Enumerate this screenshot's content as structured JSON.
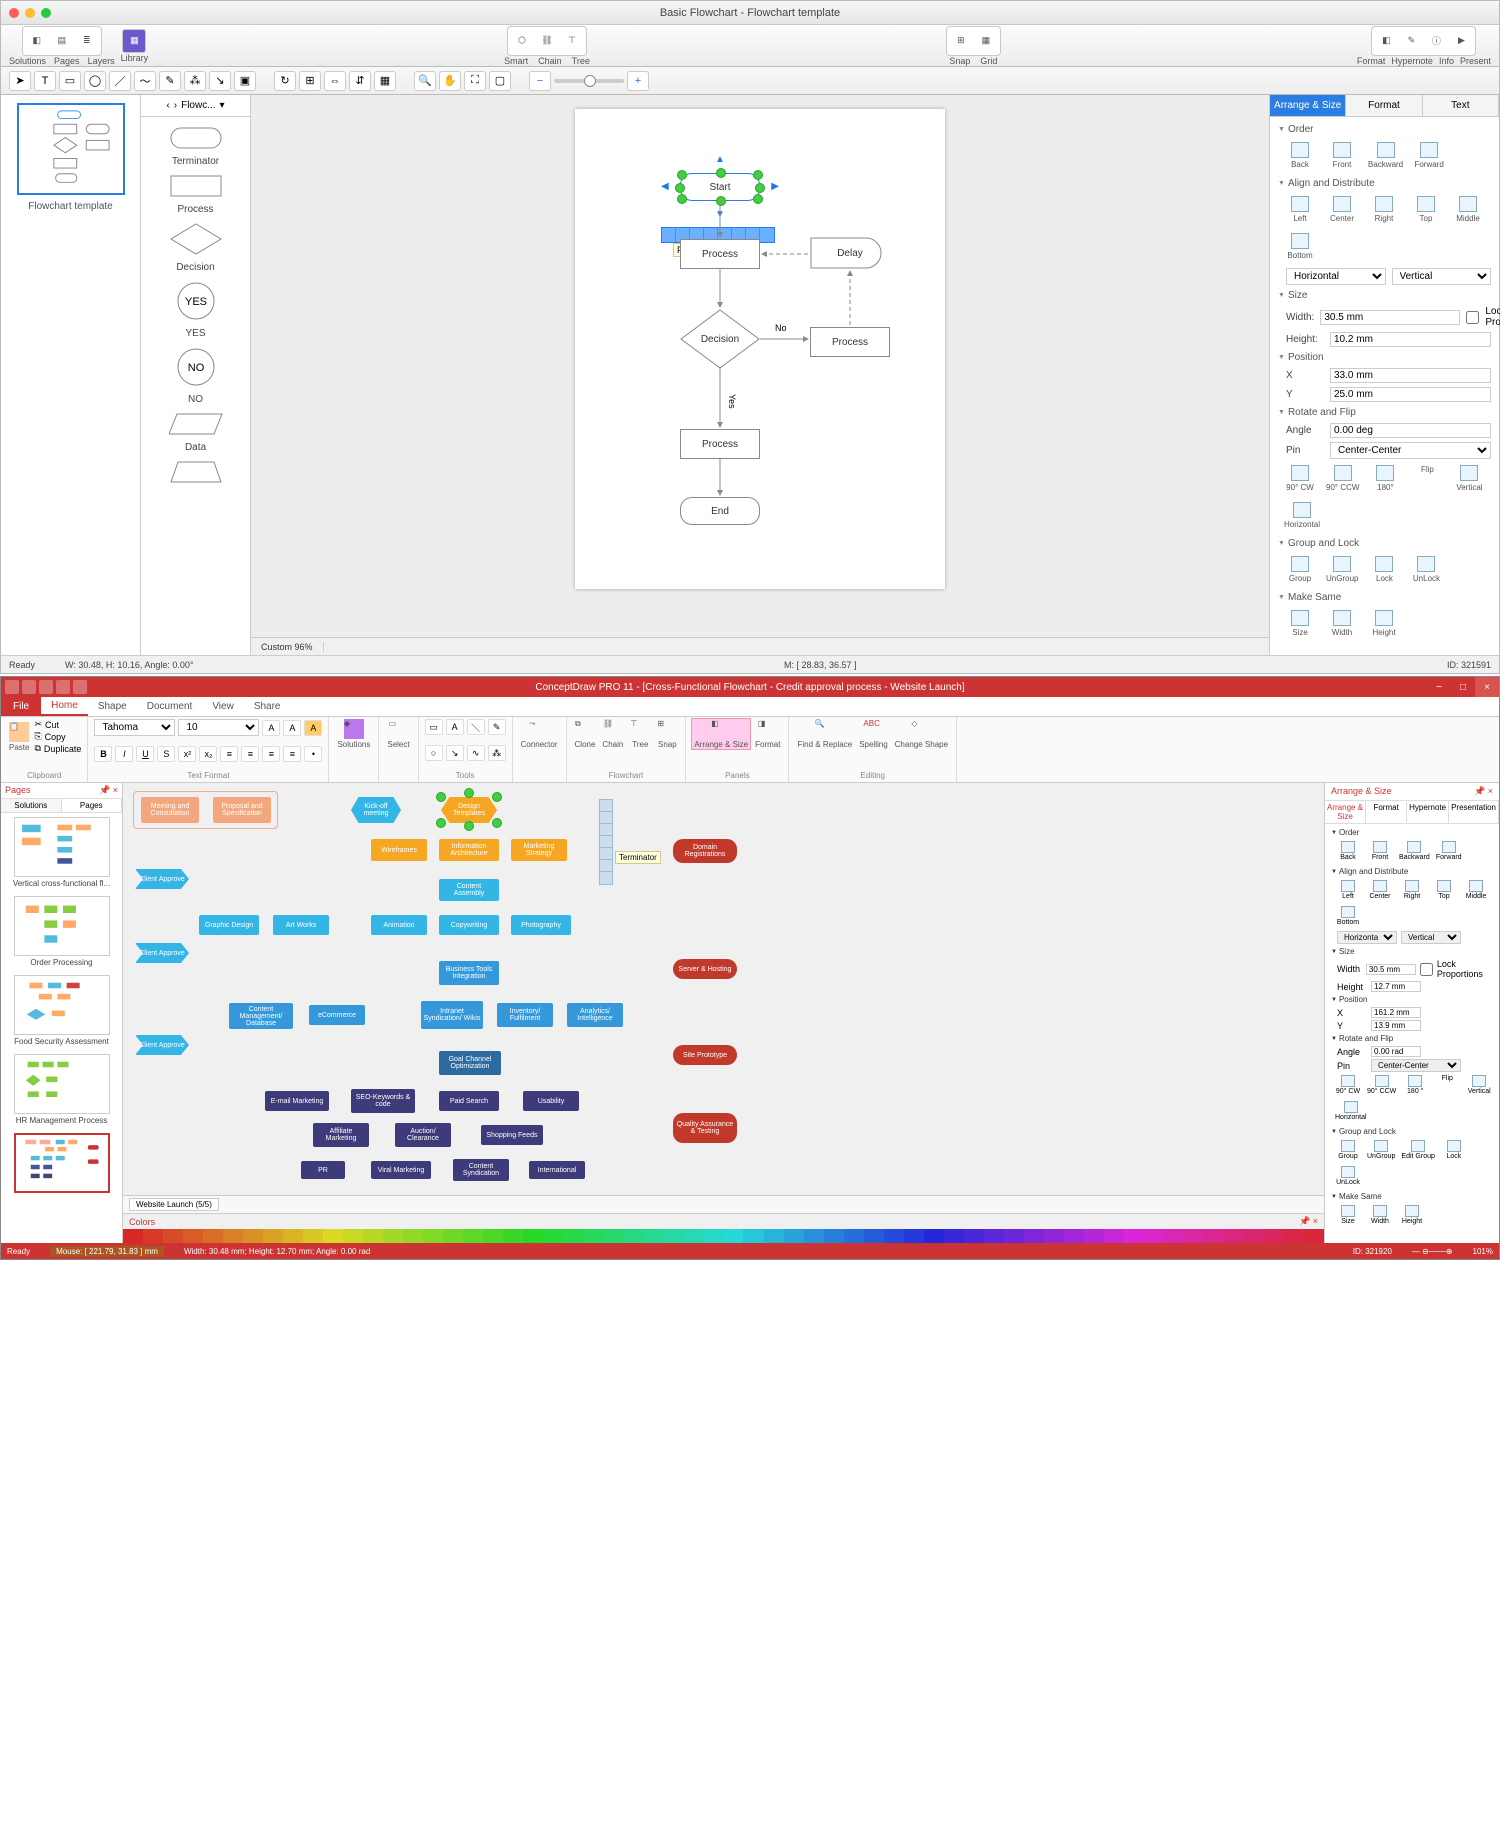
{
  "app1": {
    "title": "Basic Flowchart - Flowchart template",
    "toolbar_groups": {
      "g1": [
        "Solutions",
        "Pages",
        "Layers"
      ],
      "g2": "Library",
      "g3": [
        "Smart",
        "Chain",
        "Tree"
      ],
      "g4": [
        "Snap",
        "Grid"
      ],
      "g5": [
        "Format",
        "Hypernote",
        "Info",
        "Present"
      ]
    },
    "thumb_label": "Flowchart template",
    "stencil_tab": "Flowc...",
    "stencil": [
      "Terminator",
      "Process",
      "Decision",
      "YES",
      "NO",
      "Data"
    ],
    "canvas_status": {
      "zoom": "Custom 96%",
      "wh": "W: 30.48, H: 10.16, Angle: 0.00°",
      "mouse": "M: [ 28.83, 36.57 ]",
      "id": "ID: 321591"
    },
    "flow": {
      "start": "Start",
      "process_tip": "Process",
      "process": "Process",
      "decision": "Decision",
      "no": "No",
      "yes": "Yes",
      "delay": "Delay",
      "process2": "Process",
      "process3": "Process",
      "end": "End"
    },
    "status_ready": "Ready",
    "panel": {
      "tabs": [
        "Arrange & Size",
        "Format",
        "Text"
      ],
      "sections": {
        "order": {
          "title": "Order",
          "items": [
            "Back",
            "Front",
            "Backward",
            "Forward"
          ]
        },
        "align": {
          "title": "Align and Distribute",
          "items": [
            "Left",
            "Center",
            "Right",
            "Top",
            "Middle",
            "Bottom"
          ],
          "h": "Horizontal",
          "v": "Vertical"
        },
        "size": {
          "title": "Size",
          "w_label": "Width:",
          "w": "30.5 mm",
          "h_label": "Height:",
          "h": "10.2 mm",
          "lock": "Lock Proportions"
        },
        "position": {
          "title": "Position",
          "x_label": "X",
          "x": "33.0 mm",
          "y_label": "Y",
          "y": "25.0 mm"
        },
        "rotate": {
          "title": "Rotate and Flip",
          "angle_label": "Angle",
          "angle": "0.00 deg",
          "pin_label": "Pin",
          "pin": "Center-Center",
          "items": [
            "90° CW",
            "90° CCW",
            "180°",
            "Flip",
            "Vertical",
            "Horizontal"
          ]
        },
        "group": {
          "title": "Group and Lock",
          "items": [
            "Group",
            "UnGroup",
            "Lock",
            "UnLock"
          ]
        },
        "same": {
          "title": "Make Same",
          "items": [
            "Size",
            "Width",
            "Height"
          ]
        }
      }
    }
  },
  "app2": {
    "title": "ConceptDraw PRO 11 - [Cross-Functional Flowchart - Credit approval process - Website Launch]",
    "file": "File",
    "tabs": [
      "Home",
      "Shape",
      "Document",
      "View",
      "Share"
    ],
    "ribbon": {
      "clipboard": {
        "label": "Clipboard",
        "paste": "Paste",
        "cut": "Cut",
        "copy": "Copy",
        "dup": "Duplicate"
      },
      "font": {
        "label": "Text Format",
        "name": "Tahoma",
        "size": "10"
      },
      "solutions": "Solutions",
      "select": "Select",
      "tools": "Tools",
      "connector": "Connector",
      "flowchart": "Flowchart",
      "fc_items": [
        "Clone",
        "Chain",
        "Tree",
        "Snap"
      ],
      "panels": "Panels",
      "panel_items": [
        "Arrange & Size",
        "Format"
      ],
      "editing": "Editing",
      "edit_items": [
        "Find & Replace",
        "Spelling",
        "Change Shape"
      ]
    },
    "pages_panel": {
      "title": "Pages",
      "tabs": [
        "Solutions",
        "Pages"
      ],
      "items": [
        "Vertical cross-functional fl...",
        "Order Processing",
        "Food Security Assessment",
        "HR Management Process",
        ""
      ]
    },
    "flow": {
      "row1": [
        "Meeting and Consultation",
        "Proposal and Specification",
        "Kick-off meeting",
        "Design Templates"
      ],
      "row2": [
        "Wireframes",
        "Information Architecture",
        "Marketing Strategy"
      ],
      "approve": "Client Approve",
      "row3": "Content Assembly",
      "row4": [
        "Graphic Design",
        "Art Works",
        "Animation",
        "Copywriting",
        "Photography"
      ],
      "row5": "Business Tools Integration",
      "row6": [
        "Content Management/ Database",
        "eCommerce",
        "Intranet Syndication/ Wikis",
        "Inventory/ Fulfilment",
        "Analytics/ Intelligence"
      ],
      "row7": "Goal Channel Optimization",
      "row8": [
        "E-mail Marketing",
        "SEO-Keywords & code",
        "Paid Search",
        "Usability"
      ],
      "row9": [
        "Affiliate Marketing",
        "Auction/ Clearance",
        "Shopping Feeds"
      ],
      "row10": [
        "PR",
        "Viral Marketing",
        "Content Syndication",
        "International"
      ],
      "mile": [
        "Domain Registrations",
        "Server & Hosting",
        "Site Prototype",
        "Quality Assurance & Testing"
      ],
      "terminator_tip": "Terminator"
    },
    "tab_bottom": "Website Launch (5/5)",
    "colors_label": "Colors",
    "status": {
      "ready": "Ready",
      "mouse": "Mouse: [ 221.79, 31.83 ] mm",
      "dims": "Width: 30.48 mm;  Height: 12.70 mm;  Angle: 0.00 rad",
      "id": "ID: 321920",
      "zoom": "101%"
    },
    "panel": {
      "title": "Arrange & Size",
      "tabs": [
        "Arrange & Size",
        "Format",
        "Hypernote",
        "Presentation"
      ],
      "order": {
        "title": "Order",
        "items": [
          "Back",
          "Front",
          "Backward",
          "Forward"
        ]
      },
      "align": {
        "title": "Align and Distribute",
        "items": [
          "Left",
          "Center",
          "Right",
          "Top",
          "Middle",
          "Bottom"
        ],
        "h": "Horizontal",
        "v": "Vertical"
      },
      "size": {
        "title": "Size",
        "wl": "Width",
        "w": "30.5 mm",
        "hl": "Height",
        "h": "12.7 mm",
        "lock": "Lock Proportions"
      },
      "pos": {
        "title": "Position",
        "xl": "X",
        "x": "161.2 mm",
        "yl": "Y",
        "y": "13.9 mm"
      },
      "rot": {
        "title": "Rotate and Flip",
        "al": "Angle",
        "a": "0.00 rad",
        "pl": "Pin",
        "p": "Center-Center",
        "items": [
          "90° CW",
          "90° CCW",
          "180 °",
          "Flip",
          "Vertical",
          "Horizontal"
        ]
      },
      "grp": {
        "title": "Group and Lock",
        "items": [
          "Group",
          "UnGroup",
          "Edit Group",
          "Lock",
          "UnLock"
        ]
      },
      "same": {
        "title": "Make Same",
        "items": [
          "Size",
          "Width",
          "Height"
        ]
      }
    }
  }
}
